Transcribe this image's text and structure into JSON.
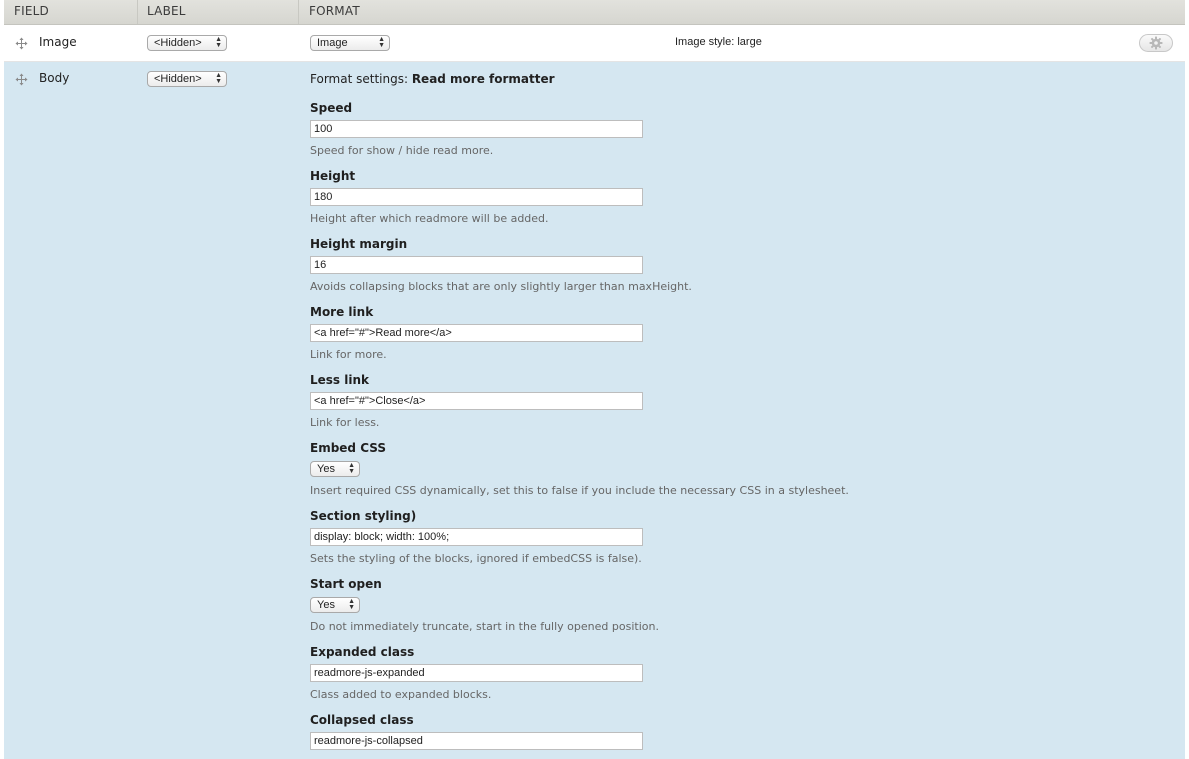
{
  "header": {
    "field": "FIELD",
    "label": "LABEL",
    "format": "FORMAT"
  },
  "rows": {
    "image": {
      "name": "Image",
      "label_select": "<Hidden>",
      "format_select": "Image",
      "summary": "Image style: large"
    },
    "body": {
      "name": "Body",
      "label_select": "<Hidden>",
      "format_settings_prefix": "Format settings: ",
      "format_settings_name": "Read more formatter"
    }
  },
  "form": {
    "speed": {
      "label": "Speed",
      "value": "100",
      "desc": "Speed for show / hide read more."
    },
    "height": {
      "label": "Height",
      "value": "180",
      "desc": "Height after which readmore will be added."
    },
    "height_margin": {
      "label": "Height margin",
      "value": "16",
      "desc": "Avoids collapsing blocks that are only slightly larger than maxHeight."
    },
    "more_link": {
      "label": "More link",
      "value": "<a href=\"#\">Read more</a>",
      "desc": "Link for more."
    },
    "less_link": {
      "label": "Less link",
      "value": "<a href=\"#\">Close</a>",
      "desc": "Link for less."
    },
    "embed_css": {
      "label": "Embed CSS",
      "value": "Yes",
      "desc": "Insert required CSS dynamically, set this to false if you include the necessary CSS in a stylesheet."
    },
    "section_styling": {
      "label": "Section styling)",
      "value": "display: block; width: 100%;",
      "desc": "Sets the styling of the blocks, ignored if embedCSS is false)."
    },
    "start_open": {
      "label": "Start open",
      "value": "Yes",
      "desc": "Do not immediately truncate, start in the fully opened position."
    },
    "expanded_class": {
      "label": "Expanded class",
      "value": "readmore-js-expanded",
      "desc": "Class added to expanded blocks."
    },
    "collapsed_class": {
      "label": "Collapsed class",
      "value": "readmore-js-collapsed"
    }
  },
  "icons": {
    "drag": "move-handle-icon",
    "settings": "gear-icon",
    "select_arrows": "up-down-arrows-icon"
  },
  "colors": {
    "header_bg": "#dcdcd6",
    "active_row_bg": "#d5e7f1",
    "row_bg": "#ffffff"
  }
}
